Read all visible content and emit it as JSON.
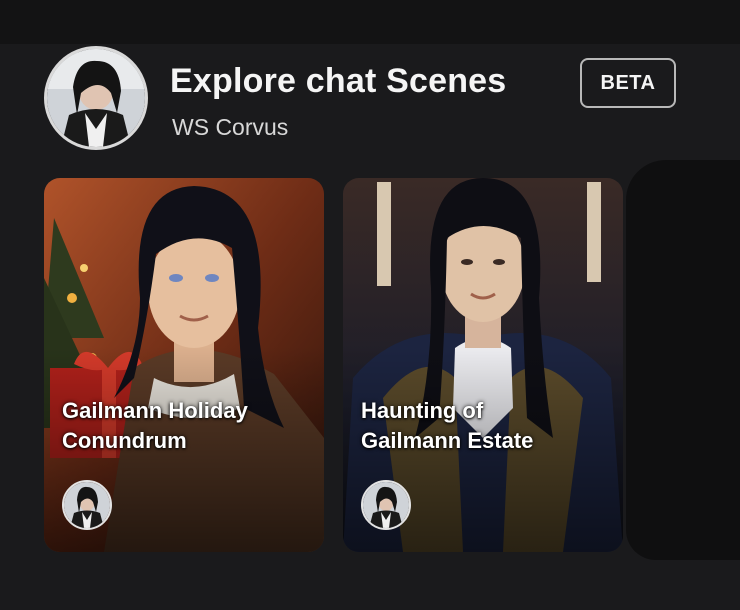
{
  "header": {
    "title": "Explore chat Scenes",
    "badge": "BETA",
    "creator": "WS Corvus"
  },
  "cards": [
    {
      "title": "Gailmann Holiday\nConundrum",
      "avatar_icon": "character-avatar-icon"
    },
    {
      "title": "Haunting of\nGailmann Estate",
      "avatar_icon": "character-avatar-icon"
    }
  ],
  "colors": {
    "background": "#1a1a1c",
    "top_bar": "#131314",
    "card1_warm": "#8a3a1c",
    "card2_cool": "#1b2236",
    "badge_border": "#b8b8b8"
  }
}
